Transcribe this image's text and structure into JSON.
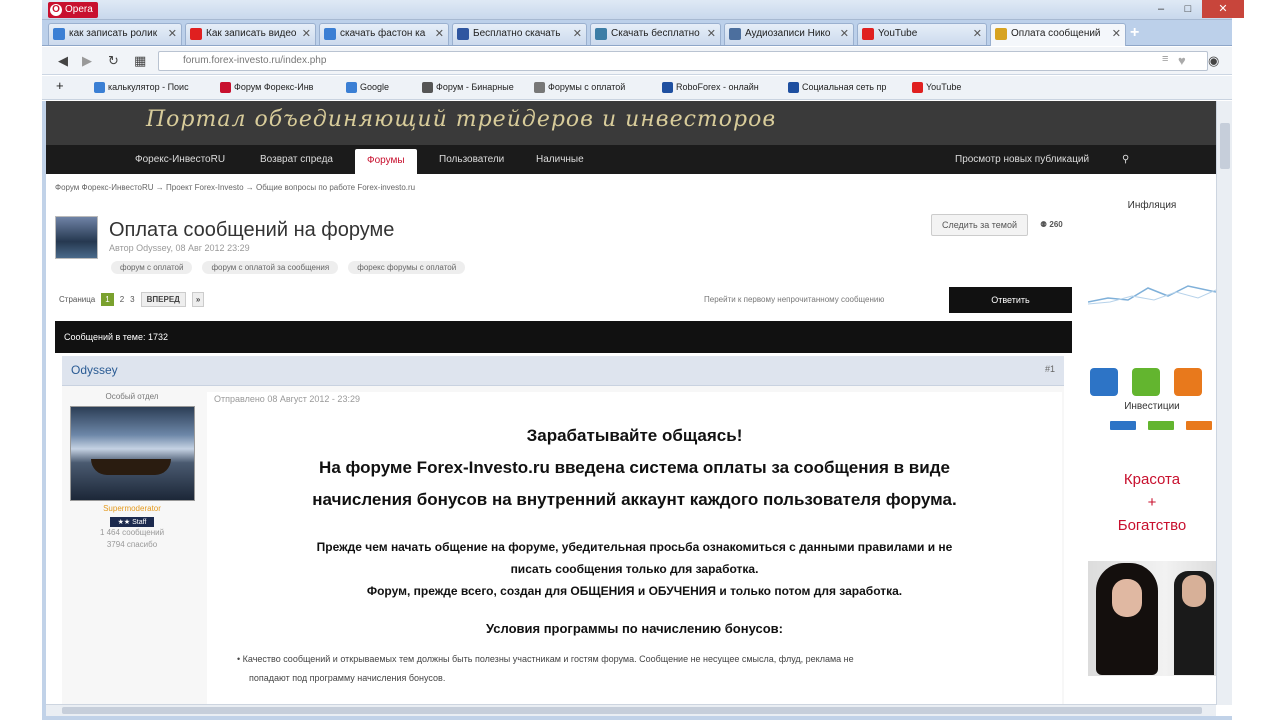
{
  "window": {
    "app_label": "Opera",
    "minimize": "–",
    "maximize": "□",
    "close": "✕"
  },
  "tabs": [
    {
      "label": "как записать ролик",
      "fav": "#3b7fd4"
    },
    {
      "label": "Как записать видео",
      "fav": "#e02020"
    },
    {
      "label": "скачать фастон ка",
      "fav": "#3b7fd4"
    },
    {
      "label": "Бесплатно скачать",
      "fav": "#2f56a0"
    },
    {
      "label": "Скачать бесплатно",
      "fav": "#3d7ea6"
    },
    {
      "label": "Аудиозаписи Нико",
      "fav": "#4c6f9e"
    },
    {
      "label": "YouTube",
      "fav": "#e02020"
    },
    {
      "label": "Оплата сообщений",
      "fav": "#d7a321",
      "active": true
    }
  ],
  "new_tab": "+",
  "address": {
    "url": "forum.forex-investo.ru/index.php"
  },
  "bookmarks": [
    {
      "label": "калькулятор - Поис",
      "fav": "#3b7fd4"
    },
    {
      "label": "Форум Форекс-Инв",
      "fav": "#c8102e"
    },
    {
      "label": "Google",
      "fav": "#3b7fd4"
    },
    {
      "label": "Форум - Бинарные",
      "fav": "#555"
    },
    {
      "label": "Форумы с оплатой",
      "fav": "#777"
    },
    {
      "label": "RoboForex - онлайн",
      "fav": "#1e4fa0"
    },
    {
      "label": "Социальная сеть пр",
      "fav": "#1e4fa0"
    },
    {
      "label": "YouTube",
      "fav": "#e02020"
    }
  ],
  "banner": {
    "slogan": "Портал объединяющий трейдеров и инвесторов"
  },
  "menu": {
    "items": [
      "Форекс-ИнвестоRU",
      "Возврат спреда",
      "Форумы",
      "Пользователи",
      "Наличные"
    ],
    "right": "Просмотр новых публикаций"
  },
  "breadcrumb": [
    "Форум Форекс-ИнвестоRU",
    "Проект Forex-Investo",
    "Общие вопросы по работе Forex-investo.ru"
  ],
  "topic": {
    "title": "Оплата сообщений на форуме",
    "meta": "Автор Odyssey, 08 Авг 2012 23:29",
    "tags": [
      "форум с оплатой",
      "форум с оплатой за сообщения",
      "форекс форумы с оплатой"
    ],
    "follow": "Следить за темой",
    "followers": "260",
    "pages_label": "Страница",
    "pages": [
      "1",
      "2",
      "3"
    ],
    "next": "ВПЕРЕД",
    "last": "»",
    "unread": "Перейти к первому непрочитанному сообщению",
    "reply": "Ответить",
    "count": "Сообщений в теме: 1732"
  },
  "post": {
    "author": "Odyssey",
    "number": "#1",
    "group": "Особый отдел",
    "rank": "Supermoderator",
    "badge": "★★   Staff",
    "messages": "1 464 сообщений",
    "thanks": "3794 спасибо",
    "date": "Отправлено 08 Август 2012 - 23:29",
    "h1": "Зарабатывайте общаясь!",
    "h2": "На форуме Forex-Investo.ru введена система оплаты за сообщения в виде",
    "h3": "начисления бонусов на внутренний аккаунт каждого пользователя форума.",
    "p1": "Прежде чем начать общение на форуме, убедительная просьба ознакомиться с данными правилами и не",
    "p2": "писать сообщения только для заработка.",
    "p3": "Форум, прежде всего, создан для ОБЩЕНИЯ и ОБУЧЕНИЯ и только потом для заработка.",
    "h4": "Условия программы по начислению бонусов:",
    "li1": "Качество сообщений и открываемых тем должны быть полезны участникам и гостям форума. Сообщение не несущее смысла, флуд, реклама не",
    "li2": "попадают под программу начисления бонусов."
  },
  "sidebar": {
    "inflation": "Инфляция",
    "investments": "Инвестиции",
    "ad1": "Красота",
    "ad2": "+",
    "ad3": "Богатство"
  }
}
